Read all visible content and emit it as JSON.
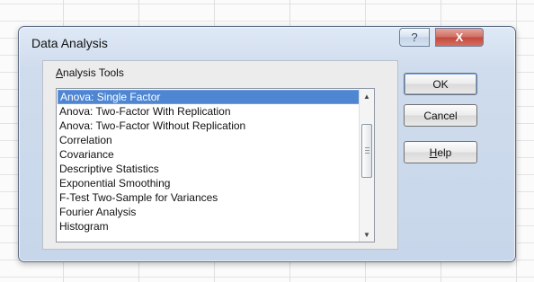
{
  "window": {
    "title": "Data Analysis",
    "titlebar_buttons": {
      "help_icon": "?",
      "close_icon": "X"
    }
  },
  "analysis_tools": {
    "label_prefix": "",
    "label_mnemonic": "A",
    "label_suffix": "nalysis Tools",
    "items": [
      "Anova: Single Factor",
      "Anova: Two-Factor With Replication",
      "Anova: Two-Factor Without Replication",
      "Correlation",
      "Covariance",
      "Descriptive Statistics",
      "Exponential Smoothing",
      "F-Test Two-Sample for Variances",
      "Fourier Analysis",
      "Histogram"
    ],
    "selected_index": 0,
    "scroll_icons": {
      "up": "▲",
      "down": "▼"
    }
  },
  "buttons": {
    "ok": "OK",
    "cancel": "Cancel",
    "help_prefix": "",
    "help_mnemonic": "H",
    "help_suffix": "elp"
  },
  "colors": {
    "selection": "#4f86d2",
    "dialog_frame": "#5f6f86",
    "close_button": "#c14a3d"
  }
}
